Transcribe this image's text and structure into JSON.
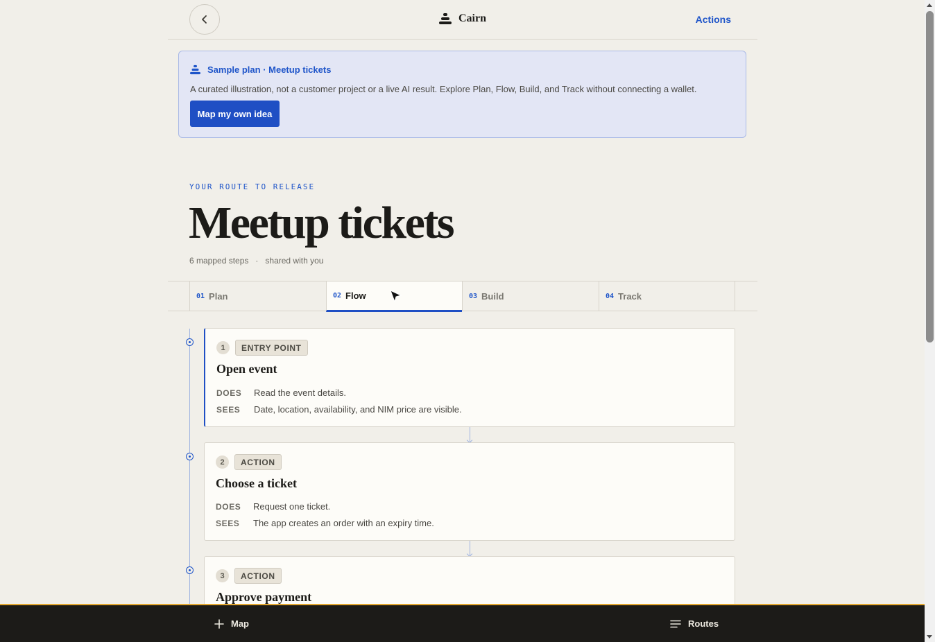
{
  "header": {
    "brand": "Cairn",
    "actions_label": "Actions"
  },
  "banner": {
    "title": "Sample plan · Meetup tickets",
    "description": "A curated illustration, not a customer project or a live AI result. Explore Plan, Flow, Build, and Track without connecting a wallet.",
    "button_label": "Map my own idea"
  },
  "hero": {
    "eyebrow": "YOUR ROUTE TO RELEASE",
    "title": "Meetup tickets",
    "steps_count": "6 mapped steps",
    "separator": "·",
    "shared": "shared with you"
  },
  "tabs": [
    {
      "num": "01",
      "label": "Plan",
      "active": false
    },
    {
      "num": "02",
      "label": "Flow",
      "active": true
    },
    {
      "num": "03",
      "label": "Build",
      "active": false
    },
    {
      "num": "04",
      "label": "Track",
      "active": false
    }
  ],
  "steps": [
    {
      "num": "1",
      "type": "ENTRY POINT",
      "title": "Open event",
      "does_key": "DOES",
      "does": "Read the event details.",
      "sees_key": "SEES",
      "sees": "Date, location, availability, and NIM price are visible."
    },
    {
      "num": "2",
      "type": "ACTION",
      "title": "Choose a ticket",
      "does_key": "DOES",
      "does": "Request one ticket.",
      "sees_key": "SEES",
      "sees": "The app creates an order with an expiry time."
    },
    {
      "num": "3",
      "type": "ACTION",
      "title": "Approve payment"
    }
  ],
  "bottom_bar": {
    "map_label": "Map",
    "routes_label": "Routes"
  },
  "colors": {
    "accent": "#1f4fc4",
    "background": "#f1efe9",
    "bottom_bar": "#1c1b18",
    "bottom_bar_border": "#e3a72f"
  },
  "icons": {
    "back": "chevron-left-icon",
    "brand": "cairn-stack-icon",
    "map": "plus-icon",
    "routes": "menu-lines-icon"
  }
}
